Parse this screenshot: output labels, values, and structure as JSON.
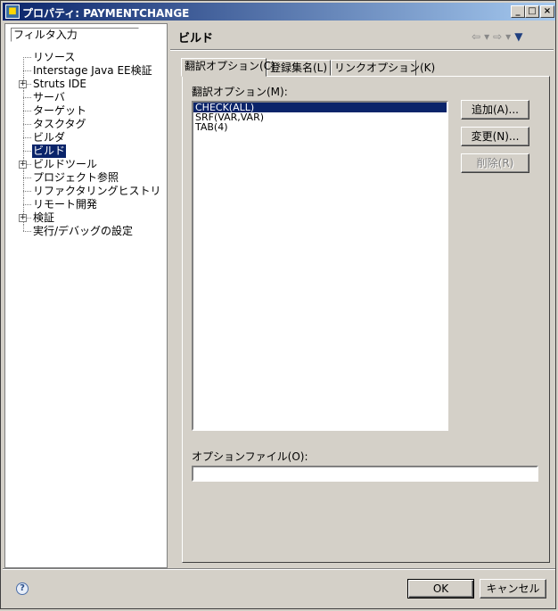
{
  "window": {
    "title": "プロパティ: PAYMENTCHANGE",
    "app_icon": "properties-app-icon",
    "controls": {
      "minimize": "_",
      "maximize": "□",
      "close": "×"
    }
  },
  "sidebar": {
    "filter_value": "フィルタ入力",
    "items": [
      {
        "label": "リソース",
        "expandable": false,
        "selected": false
      },
      {
        "label": "Interstage Java EE検証",
        "expandable": false,
        "selected": false
      },
      {
        "label": "Struts IDE",
        "expandable": true,
        "selected": false
      },
      {
        "label": "サーバ",
        "expandable": false,
        "selected": false
      },
      {
        "label": "ターゲット",
        "expandable": false,
        "selected": false
      },
      {
        "label": "タスクタグ",
        "expandable": false,
        "selected": false
      },
      {
        "label": "ビルダ",
        "expandable": false,
        "selected": false
      },
      {
        "label": "ビルド",
        "expandable": false,
        "selected": true
      },
      {
        "label": "ビルドツール",
        "expandable": true,
        "selected": false
      },
      {
        "label": "プロジェクト参照",
        "expandable": false,
        "selected": false
      },
      {
        "label": "リファクタリングヒストリ",
        "expandable": false,
        "selected": false
      },
      {
        "label": "リモート開発",
        "expandable": false,
        "selected": false
      },
      {
        "label": "検証",
        "expandable": true,
        "selected": false
      },
      {
        "label": "実行/デバッグの設定",
        "expandable": false,
        "selected": false
      }
    ]
  },
  "page": {
    "title": "ビルド",
    "nav": {
      "back": "⇦",
      "back_menu": "▾",
      "forward": "⇨",
      "forward_menu": "▾",
      "view_menu": "▼"
    }
  },
  "tabs": [
    {
      "label": "翻訳オプション(C)",
      "active": true
    },
    {
      "label": "登録集名(L)",
      "active": false
    },
    {
      "label": "リンクオプション(K)",
      "active": false
    }
  ],
  "options": {
    "list_label": "翻訳オプション(M):",
    "items": [
      {
        "text": "CHECK(ALL)",
        "selected": true
      },
      {
        "text": "SRF(VAR,VAR)",
        "selected": false
      },
      {
        "text": "TAB(4)",
        "selected": false
      }
    ],
    "add_button": "追加(A)...",
    "edit_button": "変更(N)...",
    "delete_button": "削除(R)",
    "option_file_label": "オプションファイル(O):",
    "option_file_value": ""
  },
  "footer": {
    "ok": "OK",
    "cancel": "キャンセル",
    "help": "?"
  }
}
